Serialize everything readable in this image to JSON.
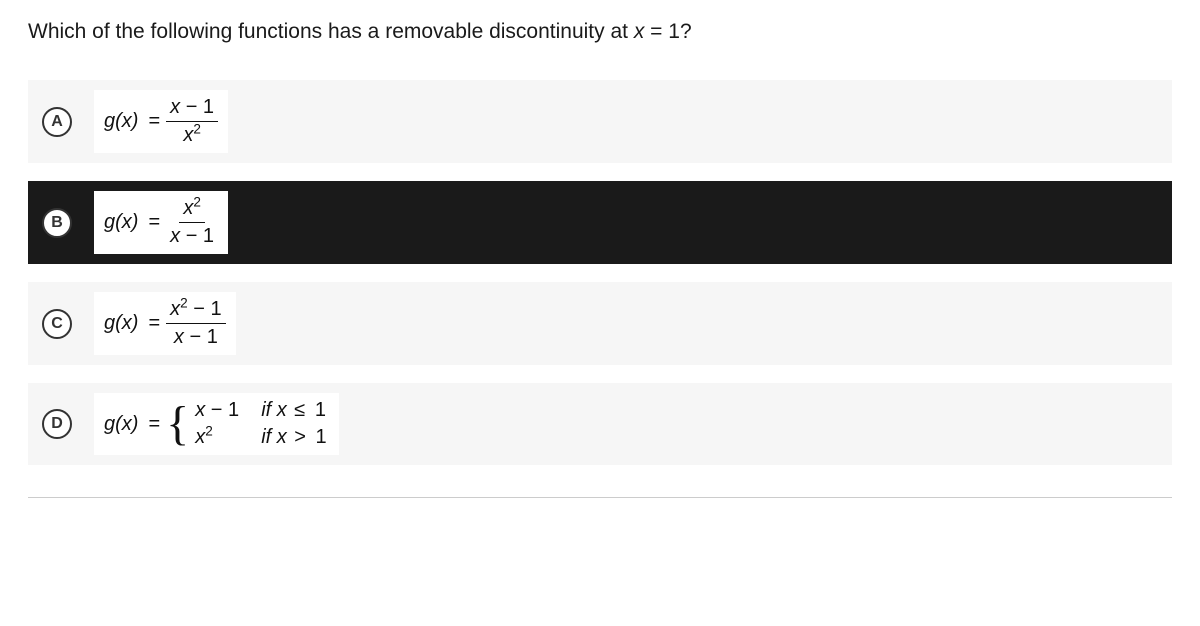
{
  "question": {
    "prefix": "Which of the following functions has a removable discontinuity at ",
    "var": "x",
    "eq": " = 1?"
  },
  "options": {
    "a": {
      "letter": "A",
      "lhs": "g(x)",
      "num_x": "x",
      "num_rest": " − 1",
      "den_x": "x",
      "den_sup": "2"
    },
    "b": {
      "letter": "B",
      "lhs": "g(x)",
      "num_x": "x",
      "num_sup": "2",
      "den_x": "x",
      "den_rest": " − 1"
    },
    "c": {
      "letter": "C",
      "lhs": "g(x)",
      "num_x": "x",
      "num_sup": "2",
      "num_rest": " − 1",
      "den_x": "x",
      "den_rest": " − 1"
    },
    "d": {
      "letter": "D",
      "lhs": "g(x)",
      "p1_x": "x",
      "p1_rest": " − 1",
      "p1_cond_if": "if ",
      "p1_cond_x": "x",
      "p1_cond_op": " ≤ ",
      "p1_cond_val": "1",
      "p2_x": "x",
      "p2_sup": "2",
      "p2_cond_if": "if ",
      "p2_cond_x": "x",
      "p2_cond_op": " > ",
      "p2_cond_val": "1"
    }
  },
  "selected": "b"
}
